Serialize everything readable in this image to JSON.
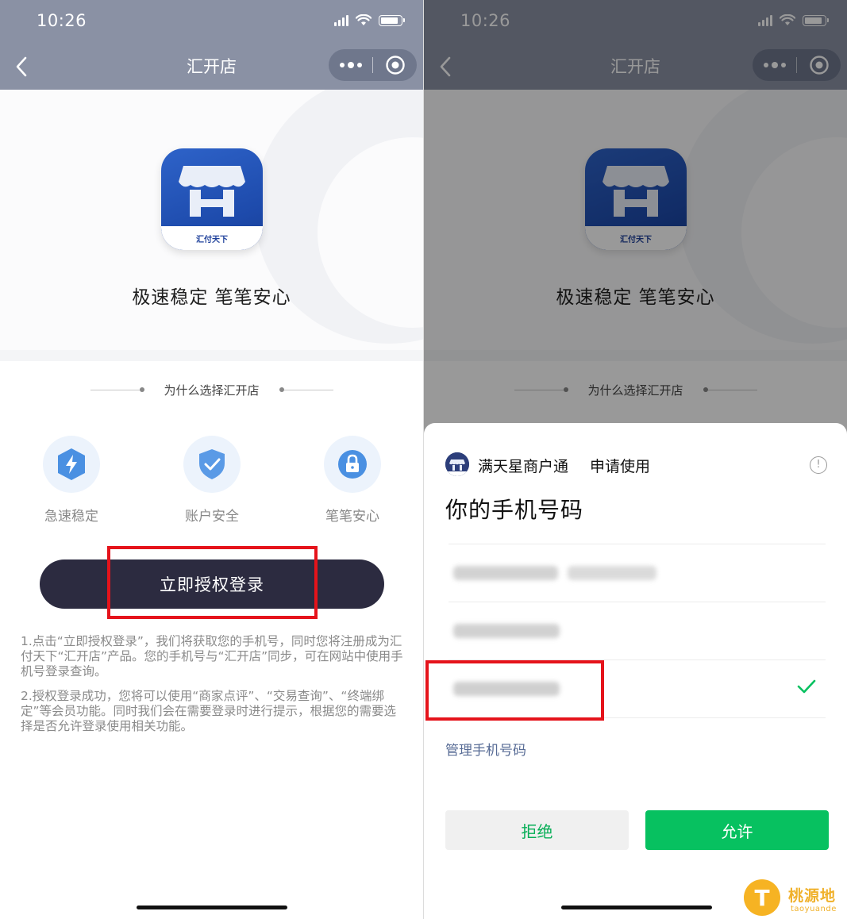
{
  "status_bar": {
    "time": "10:26"
  },
  "nav": {
    "title": "汇开店"
  },
  "hero": {
    "slogan": "极速稳定 笔笔安心",
    "logo_text": "汇付天下"
  },
  "section": {
    "why_title": "为什么选择汇开店"
  },
  "features": [
    {
      "label": "急速稳定",
      "icon": "lightning-icon"
    },
    {
      "label": "账户安全",
      "icon": "shield-check-icon"
    },
    {
      "label": "笔笔安心",
      "icon": "lock-icon"
    }
  ],
  "login_button": {
    "label": "立即授权登录"
  },
  "notes": [
    "1.点击“立即授权登录”，我们将获取您的手机号，同时您将注册成为汇付天下“汇开店”产品。您的手机号与“汇开店”同步，可在网站中使用手机号登录查询。",
    "2.授权登录成功，您将可以使用“商家点评”、“交易查询”、“终端绑定”等会员功能。同时我们会在需要登录时进行提示，根据您的需要选择是否允许登录使用相关功能。"
  ],
  "auth_sheet": {
    "app_name": "满天星商户通",
    "request_text": "申请使用",
    "info_glyph": "!",
    "title": "你的手机号码",
    "options_note": "phone numbers blurred",
    "selected_index": 2,
    "manage_link": "管理手机号码",
    "reject_label": "拒绝",
    "allow_label": "允许"
  },
  "watermark": {
    "text": "桃源地",
    "sub": "taoyuande",
    "glyph": "T"
  },
  "colors": {
    "header": "#8a91a4",
    "login_button": "#2c2b40",
    "highlight_box": "#e5131b",
    "allow_button": "#07c160",
    "reject_text": "#06ae56",
    "link": "#576b95"
  }
}
